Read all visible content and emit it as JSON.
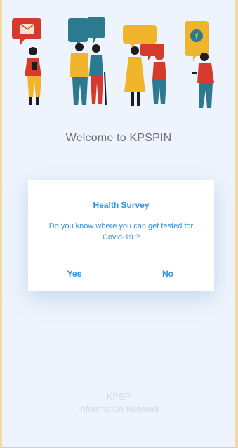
{
  "colors": {
    "accent": "#2f8ee0",
    "background": "#eef4fd",
    "frame": "#f6d9a0"
  },
  "header": {
    "welcome_text": "Welcome to KPSPIN"
  },
  "dialog": {
    "title": "Health Survey",
    "message": "Do you know where you can get tested for Covid-19 ?",
    "yes_label": "Yes",
    "no_label": "No"
  },
  "footer": {
    "line1": "KPSP",
    "line2": "Information Network"
  },
  "icons": [
    "email-icon",
    "facebook-icon"
  ]
}
